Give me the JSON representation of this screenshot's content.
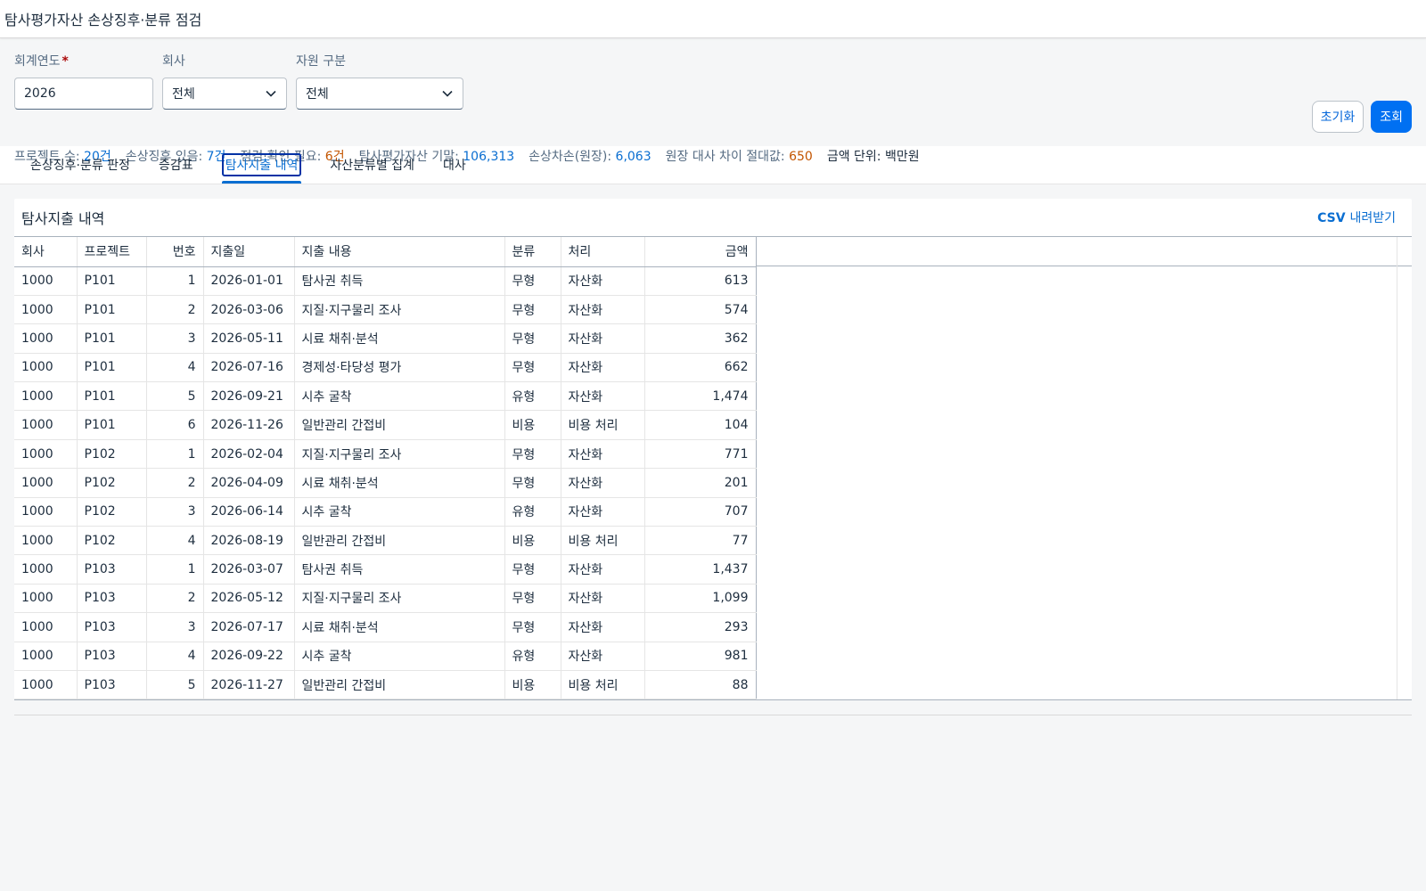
{
  "app": {
    "title": "탐사평가자산 손상징후·분류 점검"
  },
  "filters": {
    "year": {
      "label": "회계연도",
      "required_mark": "*",
      "value": "2026"
    },
    "company": {
      "label": "회사",
      "value": "전체"
    },
    "resource": {
      "label": "자원 구분",
      "value": "전체"
    }
  },
  "actions": {
    "reset_label": "초기화",
    "search_label": "조회"
  },
  "summary": {
    "projects_label": "프로젝트 수:",
    "projects_value": "20건",
    "impairment_label": "손상징후 있음:",
    "impairment_value": "7건",
    "check_label": "점검·확인 필요:",
    "check_value": "6건",
    "ending_label": "탐사평가자산 기말:",
    "ending_value": "106,313",
    "loss_label": "손상차손(원장):",
    "loss_value": "6,063",
    "diff_label": "원장 대사 차이 절대값:",
    "diff_value": "650",
    "unit_label": "금액 단위: 백만원"
  },
  "tabs": [
    {
      "label": "손상징후·분류 판정"
    },
    {
      "label": "증감표"
    },
    {
      "label": "탐사지출 내역"
    },
    {
      "label": "자산분류별 집계"
    },
    {
      "label": "대사"
    }
  ],
  "active_tab": 2,
  "panel": {
    "title": "탐사지출 내역",
    "csv_bold": "CSV",
    "csv_rest": "내려받기"
  },
  "table": {
    "headers": [
      "회사",
      "프로젝트",
      "번호",
      "지출일",
      "지출 내용",
      "분류",
      "처리",
      "금액"
    ],
    "rows": [
      [
        "1000",
        "P101",
        "1",
        "2026-01-01",
        "탐사권 취득",
        "무형",
        "자산화",
        "613"
      ],
      [
        "1000",
        "P101",
        "2",
        "2026-03-06",
        "지질·지구물리 조사",
        "무형",
        "자산화",
        "574"
      ],
      [
        "1000",
        "P101",
        "3",
        "2026-05-11",
        "시료 채취·분석",
        "무형",
        "자산화",
        "362"
      ],
      [
        "1000",
        "P101",
        "4",
        "2026-07-16",
        "경제성·타당성 평가",
        "무형",
        "자산화",
        "662"
      ],
      [
        "1000",
        "P101",
        "5",
        "2026-09-21",
        "시추 굴착",
        "유형",
        "자산화",
        "1,474"
      ],
      [
        "1000",
        "P101",
        "6",
        "2026-11-26",
        "일반관리 간접비",
        "비용",
        "비용 처리",
        "104"
      ],
      [
        "1000",
        "P102",
        "1",
        "2026-02-04",
        "지질·지구물리 조사",
        "무형",
        "자산화",
        "771"
      ],
      [
        "1000",
        "P102",
        "2",
        "2026-04-09",
        "시료 채취·분석",
        "무형",
        "자산화",
        "201"
      ],
      [
        "1000",
        "P102",
        "3",
        "2026-06-14",
        "시추 굴착",
        "유형",
        "자산화",
        "707"
      ],
      [
        "1000",
        "P102",
        "4",
        "2026-08-19",
        "일반관리 간접비",
        "비용",
        "비용 처리",
        "77"
      ],
      [
        "1000",
        "P103",
        "1",
        "2026-03-07",
        "탐사권 취득",
        "무형",
        "자산화",
        "1,437"
      ],
      [
        "1000",
        "P103",
        "2",
        "2026-05-12",
        "지질·지구물리 조사",
        "무형",
        "자산화",
        "1,099"
      ],
      [
        "1000",
        "P103",
        "3",
        "2026-07-17",
        "시료 채취·분석",
        "무형",
        "자산화",
        "293"
      ],
      [
        "1000",
        "P103",
        "4",
        "2026-09-22",
        "시추 굴착",
        "유형",
        "자산화",
        "981"
      ],
      [
        "1000",
        "P103",
        "5",
        "2026-11-27",
        "일반관리 간접비",
        "비용",
        "비용 처리",
        "88"
      ]
    ]
  },
  "colors": {
    "accent": "#0a6ed1",
    "primary_button": "#0070f2",
    "warning_text": "#c35500"
  }
}
